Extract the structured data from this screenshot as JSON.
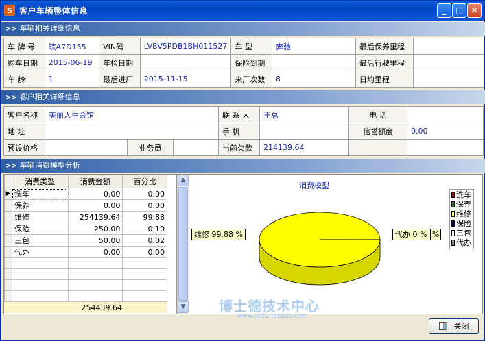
{
  "window": {
    "title": "客户车辆整体信息",
    "app_icon": "S"
  },
  "sections": {
    "vehicle": "车辆相关详细信息",
    "customer": "客户相关详细信息",
    "analysis": "车辆消费模型分析"
  },
  "vehicle": {
    "plate_label": "车 牌 号",
    "plate": "皖A7D155",
    "vin_label": "VIN码",
    "vin": "LVBV5PDB1BH011527",
    "model_label": "车      型",
    "model": "奔驰",
    "last_service_km_label": "最后保养里程",
    "last_service_km": "",
    "buy_date_label": "购车日期",
    "buy_date": "2015-06-19",
    "inspect_date_label": "年检日期",
    "inspect_date": "",
    "insurance_label": "保险到期",
    "insurance": "",
    "last_km_label": "最后行驶里程",
    "last_km": "",
    "age_label": "车      龄",
    "age": "1",
    "last_visit_label": "最后进厂",
    "last_visit": "2015-11-15",
    "visits_label": "来厂次数",
    "visits": "8",
    "daily_km_label": "日均里程",
    "daily_km": ""
  },
  "customer": {
    "name_label": "客户名称",
    "name": "美丽人生会馆",
    "contact_label": "联 系 人",
    "contact": "王总",
    "phone_label": "电      话",
    "phone": "",
    "address_label": "地      址",
    "address": "",
    "mobile_label": "手      机",
    "mobile": "",
    "credit_label": "信誉额度",
    "credit": "0.00",
    "preset_price_label": "预设价格",
    "preset_price": "",
    "salesman_label": "业务员",
    "salesman": "",
    "debt_label": "当前欠款",
    "debt": "214139.64"
  },
  "table": {
    "headers": [
      "消费类型",
      "消费金额",
      "百分比"
    ],
    "rows": [
      [
        "洗车",
        "0.00",
        "0.00"
      ],
      [
        "保养",
        "0.00",
        "0.00"
      ],
      [
        "维修",
        "254139.64",
        "99.88"
      ],
      [
        "保险",
        "250.00",
        "0.10"
      ],
      [
        "三包",
        "50.00",
        "0.02"
      ],
      [
        "代办",
        "0.00",
        "0.00"
      ]
    ],
    "total": "254439.64"
  },
  "chart_data": {
    "type": "pie",
    "title": "消费模型",
    "categories": [
      "洗车",
      "保养",
      "维修",
      "保险",
      "三包",
      "代办"
    ],
    "values": [
      0.0,
      0.0,
      254139.64,
      250.0,
      50.0,
      0.0
    ],
    "colors": [
      "#cc0000",
      "#1a8a1a",
      "#ffff00",
      "#000080",
      "#ffffff",
      "#808080"
    ],
    "labels": [
      {
        "text": "维修 99.88 %"
      },
      {
        "text": "代办 0 %"
      },
      {
        "text": "%"
      }
    ],
    "legend_position": "top-right"
  },
  "watermark": {
    "main": "博士德技术中心",
    "url": "www.pc52.taobao.com"
  },
  "buttons": {
    "close": "关闭"
  }
}
